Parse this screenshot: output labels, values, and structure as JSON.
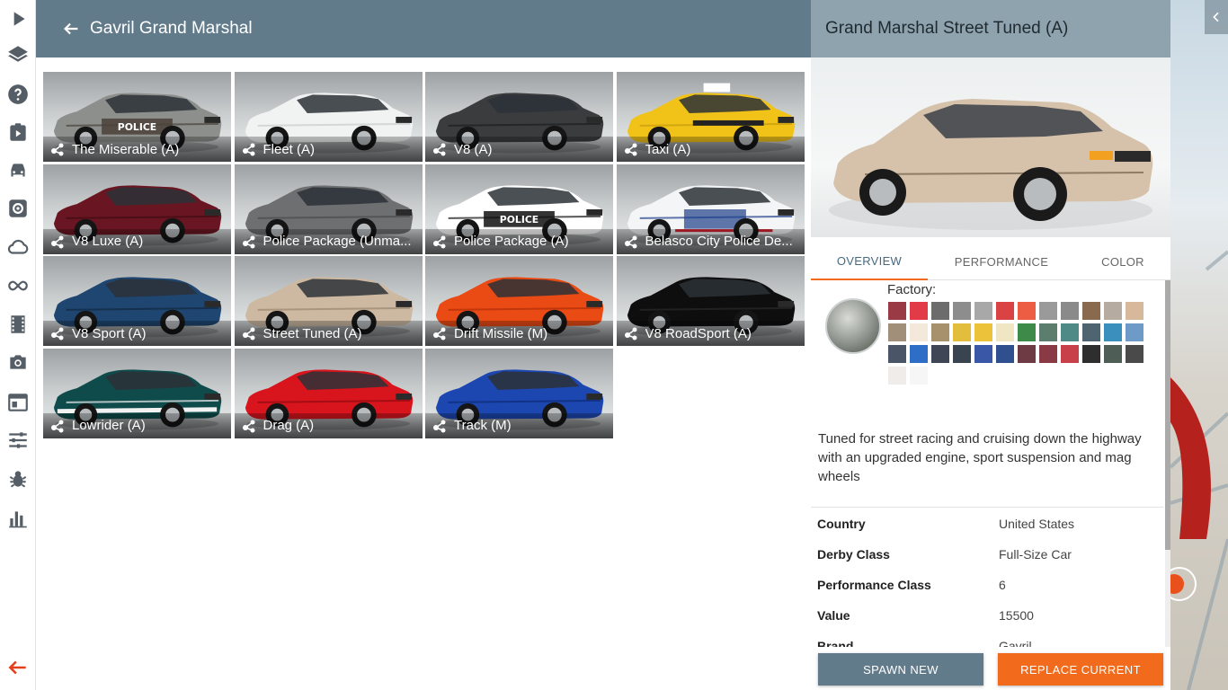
{
  "header": {
    "title": "Gavril Grand Marshal"
  },
  "configs": [
    {
      "label": "The Miserable (A)",
      "color": "#8d8f8c",
      "accent": "#4a4138",
      "livery": "police-rust"
    },
    {
      "label": "Fleet (A)",
      "color": "#f1f2f2",
      "accent": "#c9cbcc",
      "livery": "none"
    },
    {
      "label": "V8 (A)",
      "color": "#3b3c3e",
      "accent": "#1d1e1f",
      "livery": "none"
    },
    {
      "label": "Taxi (A)",
      "color": "#f1c319",
      "accent": "#c79a0c",
      "livery": "taxi"
    },
    {
      "label": "V8 Luxe (A)",
      "color": "#6a1622",
      "accent": "#3e0c13",
      "livery": "none"
    },
    {
      "label": "Police Package (Unma...",
      "color": "#6e6f70",
      "accent": "#4a4b4c",
      "livery": "none"
    },
    {
      "label": "Police Package (A)",
      "color": "#ffffff",
      "accent": "#111111",
      "livery": "police"
    },
    {
      "label": "Belasco City Police De...",
      "color": "#f4f5f6",
      "accent": "#1e3f8a",
      "livery": "belasco"
    },
    {
      "label": "V8 Sport (A)",
      "color": "#1f4670",
      "accent": "#112840",
      "livery": "none"
    },
    {
      "label": "Street Tuned (A)",
      "color": "#cdb9a2",
      "accent": "#9a876f",
      "livery": "none"
    },
    {
      "label": "Drift Missile (M)",
      "color": "#ea4a14",
      "accent": "#b0300a",
      "livery": "none"
    },
    {
      "label": "V8 RoadSport (A)",
      "color": "#0e0e0f",
      "accent": "#2a2a2b",
      "livery": "none"
    },
    {
      "label": "Lowrider (A)",
      "color": "#0f4b4b",
      "accent": "#f2f2f2",
      "livery": "lowrider"
    },
    {
      "label": "Drag (A)",
      "color": "#d8141d",
      "accent": "#8f0b10",
      "livery": "none"
    },
    {
      "label": "Track (M)",
      "color": "#1c46b0",
      "accent": "#0f2a74",
      "livery": "none"
    }
  ],
  "detail": {
    "title": "Grand Marshal Street Tuned (A)",
    "preview_color": "#d6c2ab",
    "tabs": [
      {
        "label": "OVERVIEW"
      },
      {
        "label": "PERFORMANCE"
      },
      {
        "label": "COLOR"
      }
    ],
    "factory_label": "Factory:",
    "swatches": [
      "#9a3a44",
      "#e23a47",
      "#6c6c6c",
      "#8d8d8d",
      "#a8a8a8",
      "#d94343",
      "#ec5d44",
      "#9a9a9a",
      "#8a8a8a",
      "#8a6a4e",
      "#b6aba0",
      "#d8b89a",
      "#a28f7a",
      "#f3e8da",
      "#a6916c",
      "#e3bd3c",
      "#ecc23a",
      "#f1e6c4",
      "#3e8a48",
      "#5c7e6e",
      "#4f8a86",
      "#4e6470",
      "#3a8fbd",
      "#6e9ac8",
      "#4a5668",
      "#2e6ec6",
      "#3f4656",
      "#3a4350",
      "#3a56a6",
      "#2f4f8e",
      "#6e3a44",
      "#8a3a44",
      "#c8404a",
      "#2e2e2e",
      "#4e5e56",
      "#4a4a4a",
      "#f0ecea",
      "#f6f6f6"
    ],
    "description": "Tuned for street racing and cruising down the highway with an upgraded engine, sport suspension and mag wheels",
    "specs": [
      {
        "key": "Country",
        "value": "United States"
      },
      {
        "key": "Derby Class",
        "value": "Full-Size Car"
      },
      {
        "key": "Performance Class",
        "value": "6"
      },
      {
        "key": "Value",
        "value": "15500"
      },
      {
        "key": "Brand",
        "value": "Gavril"
      }
    ],
    "spawn_label": "SPAWN NEW",
    "replace_label": "REPLACE CURRENT"
  },
  "colors": {
    "header": "#627b8b",
    "detail_header": "#8fa3af",
    "accent": "#f26a1b"
  }
}
